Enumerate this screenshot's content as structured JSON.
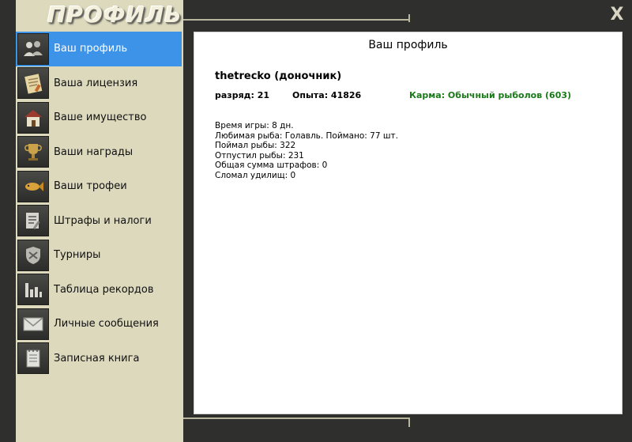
{
  "window": {
    "title": "ПРОФИЛЬ",
    "close_label": "X"
  },
  "sidebar": {
    "items": [
      {
        "label": "Ваш профиль",
        "icon": "users-icon",
        "active": true
      },
      {
        "label": "Ваша лицензия",
        "icon": "license-icon",
        "active": false
      },
      {
        "label": "Ваше имущество",
        "icon": "house-icon",
        "active": false
      },
      {
        "label": "Ваши награды",
        "icon": "trophy-icon",
        "active": false
      },
      {
        "label": "Ваши трофеи",
        "icon": "fish-trophy-icon",
        "active": false
      },
      {
        "label": "Штрафы и налоги",
        "icon": "fines-icon",
        "active": false
      },
      {
        "label": "Турниры",
        "icon": "tournament-icon",
        "active": false
      },
      {
        "label": "Таблица рекордов",
        "icon": "records-chart-icon",
        "active": false
      },
      {
        "label": "Личные сообщения",
        "icon": "envelope-icon",
        "active": false
      },
      {
        "label": "Записная книга",
        "icon": "notebook-icon",
        "active": false
      }
    ]
  },
  "profile": {
    "title": "Ваш профиль",
    "username": "thetrecko (доночник)",
    "rank": "разряд: 21",
    "experience": "Опыта: 41826",
    "karma": "Карма: Обычный рыболов (603)",
    "details": [
      "Время игры: 8 дн.",
      "Любимая рыба: Голавль. Поймано: 77 шт.",
      "Поймал рыбы: 322",
      "Отпустил рыбы: 231",
      "Общая сумма штрафов: 0",
      "Сломал удилищ: 0"
    ]
  },
  "colors": {
    "sidebar_bg": "#dcd9bd",
    "frame_dark": "#2f2f2e",
    "active_item": "#3c93e8",
    "karma_green": "#1a7a1a"
  }
}
